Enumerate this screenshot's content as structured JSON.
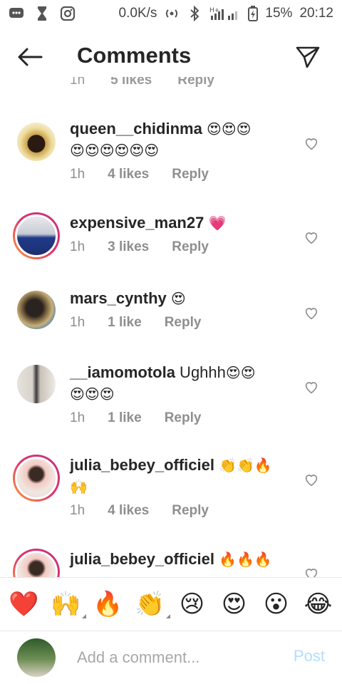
{
  "statusbar": {
    "speed": "0.0K/s",
    "network": "H+",
    "battery": "15%",
    "time": "20:12"
  },
  "header": {
    "title": "Comments"
  },
  "partial_previous": {
    "time": "1h",
    "likes": "5 likes",
    "reply": "Reply"
  },
  "comments": [
    {
      "username": "queen__chidinma",
      "text": "",
      "emoji_line1": "😍😍😍",
      "emoji_line2": "😍😍😍😍😍😍",
      "time": "1h",
      "likes": "4 likes",
      "reply": "Reply"
    },
    {
      "username": "expensive_man27",
      "text": "",
      "emoji_line1": "💗",
      "time": "1h",
      "likes": "3 likes",
      "reply": "Reply"
    },
    {
      "username": "mars_cynthy",
      "text": "",
      "emoji_line1": "😍",
      "time": "1h",
      "likes": "1 like",
      "reply": "Reply"
    },
    {
      "username": "__iamomotola",
      "text": " Ughhh",
      "emoji_line1": "😍😍",
      "emoji_line2": "😍😍😍",
      "time": "1h",
      "likes": "1 like",
      "reply": "Reply"
    },
    {
      "username": "julia_bebey_officiel",
      "text": "",
      "emoji_line1": "👏👏🔥",
      "emoji_line2": "🙌",
      "time": "1h",
      "likes": "4 likes",
      "reply": "Reply"
    },
    {
      "username": "julia_bebey_officiel",
      "text": "",
      "emoji_line1": "🔥🔥🔥",
      "time": "",
      "likes": "",
      "reply": ""
    }
  ],
  "emoji_bar": [
    "❤️",
    "🙌",
    "🔥",
    "👏",
    "😢",
    "😍",
    "😮",
    "😂"
  ],
  "composer": {
    "placeholder": "Add a comment...",
    "post_label": "Post"
  },
  "colors": {
    "text": "#262626",
    "meta": "#8e8e8e",
    "post_disabled": "#b2dffc",
    "heart_pink": "#e84c7d"
  }
}
